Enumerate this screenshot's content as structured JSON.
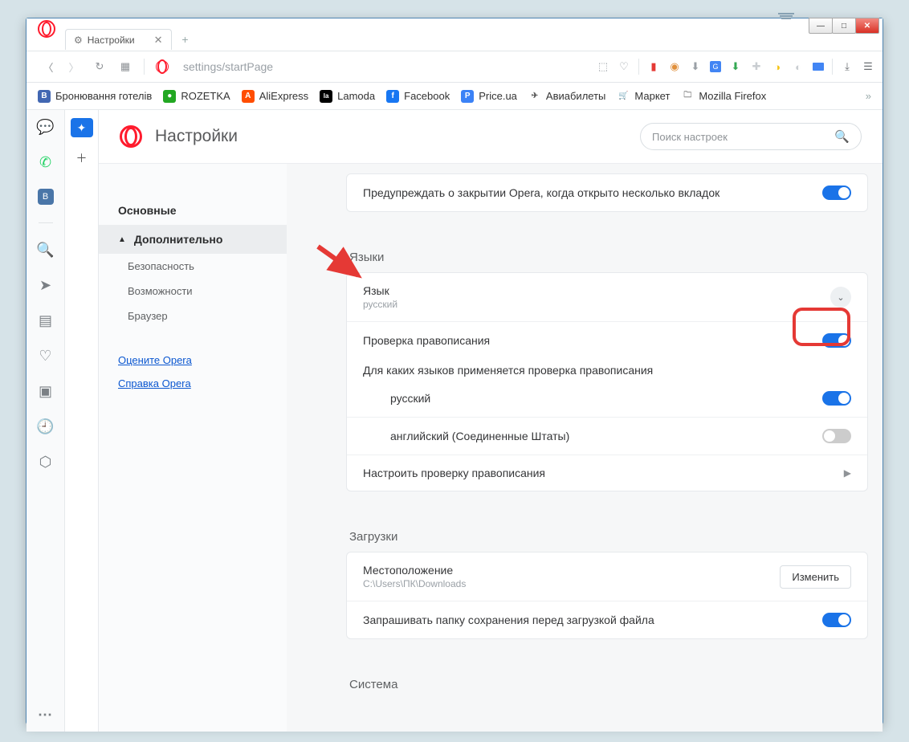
{
  "window": {
    "min": "—",
    "max": "□",
    "close": "✕"
  },
  "tab": {
    "title": "Настройки",
    "close": "✕",
    "new": "+"
  },
  "address": {
    "url_main": "settings/",
    "url_sub": "startPage"
  },
  "bookmarks": [
    {
      "label": "Бронювання готелів",
      "bg": "#4267b2",
      "ch": "B"
    },
    {
      "label": "ROZETKA",
      "bg": "#22a722",
      "ch": "●"
    },
    {
      "label": "AliExpress",
      "bg": "#ff4d00",
      "ch": "A"
    },
    {
      "label": "Lamoda",
      "bg": "#000",
      "ch": "la"
    },
    {
      "label": "Facebook",
      "bg": "#1877f2",
      "ch": "f"
    },
    {
      "label": "Price.ua",
      "bg": "#3b82f6",
      "ch": "P"
    },
    {
      "label": "Авиабилеты",
      "bg": "#f5c518",
      "ch": "✈"
    },
    {
      "label": "Маркет",
      "bg": "#f5c518",
      "ch": "🛒"
    },
    {
      "label": "Mozilla Firefox",
      "bg": "transparent",
      "ch": "📁"
    }
  ],
  "settings_header": {
    "title": "Настройки",
    "search_ph": "Поиск настроек"
  },
  "sidebar": {
    "basic": "Основные",
    "advanced": "Дополнительно",
    "security": "Безопасность",
    "features": "Возможности",
    "browser": "Браузер",
    "rate": "Оцените Opera",
    "help": "Справка Opera"
  },
  "main": {
    "warn_close": "Предупреждать о закрытии Opera, когда открыто несколько вкладок",
    "sec_lang": "Языки",
    "lang_title": "Язык",
    "lang_value": "русский",
    "spellcheck": "Проверка правописания",
    "spell_for": "Для каких языков применяется проверка правописания",
    "lang_ru": "русский",
    "lang_en": "английский (Соединенные Штаты)",
    "spell_config": "Настроить проверку правописания",
    "sec_downloads": "Загрузки",
    "loc_title": "Местоположение",
    "loc_value": "C:\\Users\\ПК\\Downloads",
    "change": "Изменить",
    "ask_save": "Запрашивать папку сохранения перед загрузкой файла",
    "sec_system": "Система"
  }
}
